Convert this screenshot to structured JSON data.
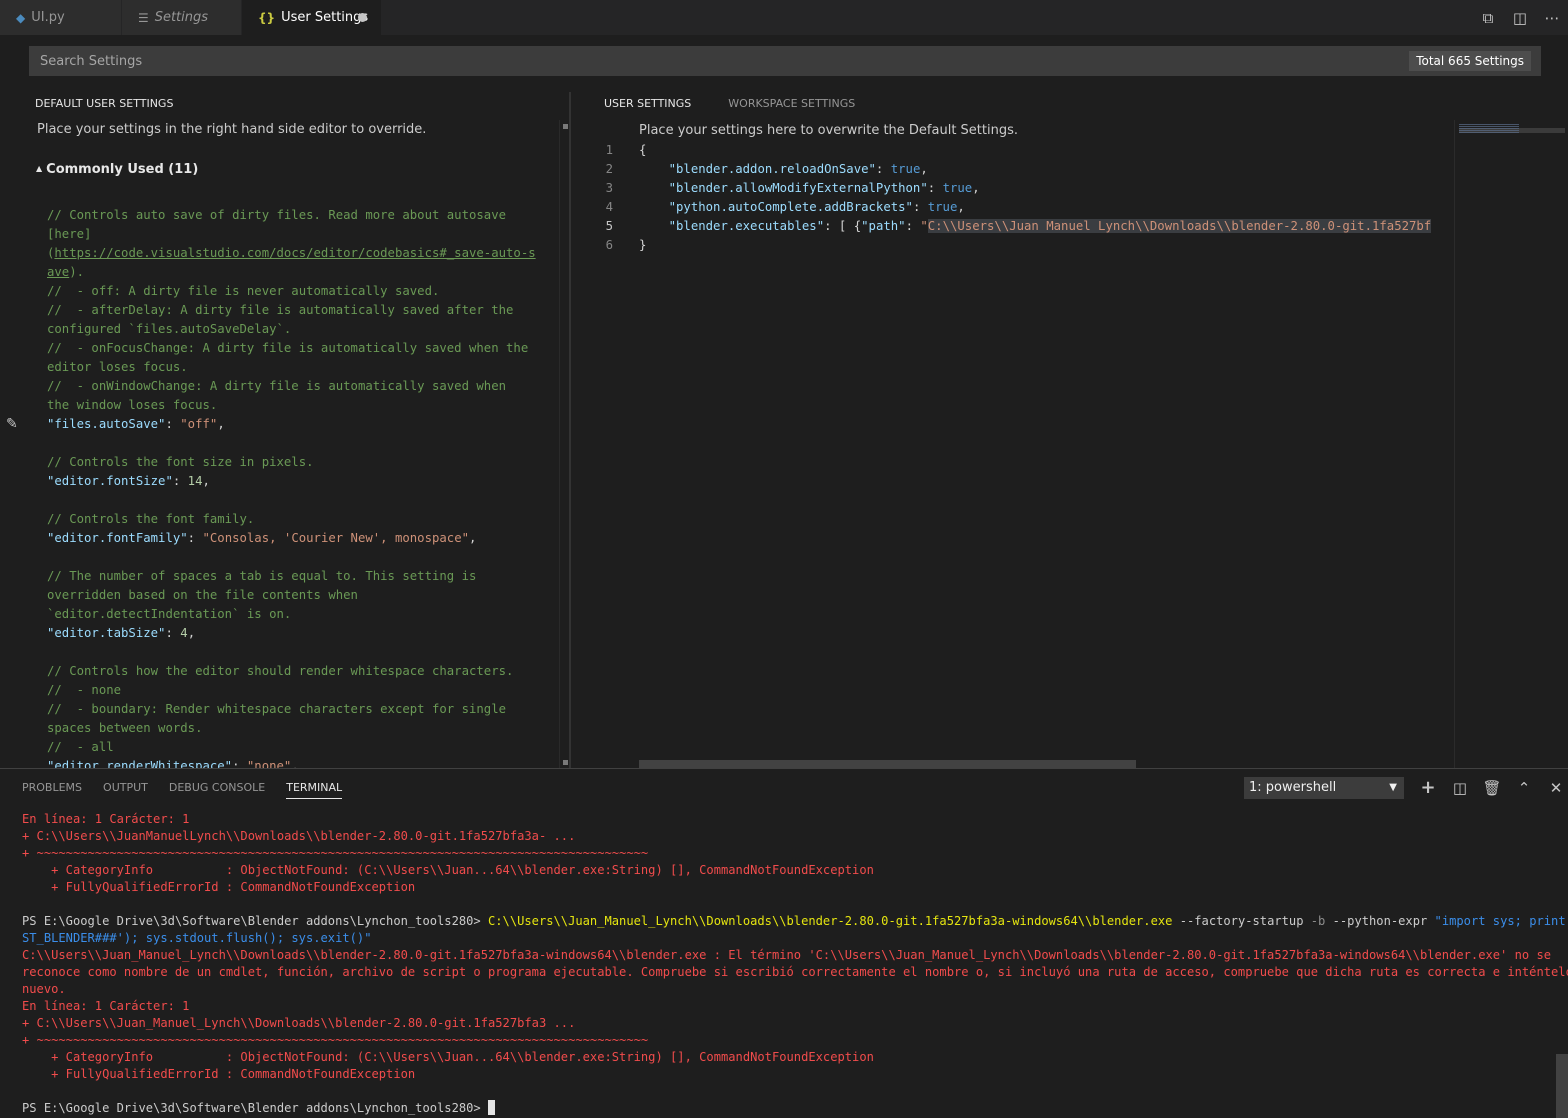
{
  "tabs": [
    {
      "label": "UI.py",
      "icon": "python-icon"
    },
    {
      "label": "Settings",
      "icon": "settings-list-icon"
    },
    {
      "label": "User Settings",
      "icon": "json-braces-icon",
      "dirty": true
    }
  ],
  "tab_actions": [
    "open-changes-icon",
    "split-editor-icon",
    "more-actions-icon"
  ],
  "search": {
    "placeholder": "Search Settings",
    "total": "Total 665 Settings"
  },
  "left": {
    "header": "DEFAULT USER SETTINGS",
    "hint": "Place your settings in the right hand side editor to override.",
    "group": "Commonly Used (11)",
    "code": [
      [
        [
          "cm",
          "// Controls auto save of dirty files. Read more about autosave"
        ]
      ],
      [
        [
          "cm",
          "[here]"
        ]
      ],
      [
        [
          "cm",
          "("
        ],
        [
          "cm lnk",
          "https://code.visualstudio.com/docs/editor/codebasics#_save-auto-s"
        ]
      ],
      [
        [
          "cm lnk",
          "ave"
        ],
        [
          "cm",
          ")."
        ]
      ],
      [
        [
          "cm",
          "//  - off: A dirty file is never automatically saved."
        ]
      ],
      [
        [
          "cm",
          "//  - afterDelay: A dirty file is automatically saved after the"
        ]
      ],
      [
        [
          "cm",
          "configured `files.autoSaveDelay`."
        ]
      ],
      [
        [
          "cm",
          "//  - onFocusChange: A dirty file is automatically saved when the"
        ]
      ],
      [
        [
          "cm",
          "editor loses focus."
        ]
      ],
      [
        [
          "cm",
          "//  - onWindowChange: A dirty file is automatically saved when"
        ]
      ],
      [
        [
          "cm",
          "the window loses focus."
        ]
      ],
      [
        [
          "ky",
          "\"files.autoSave\""
        ],
        [
          "pl",
          ": "
        ],
        [
          "st",
          "\"off\""
        ],
        [
          "pl",
          ","
        ]
      ],
      [],
      [
        [
          "cm",
          "// Controls the font size in pixels."
        ]
      ],
      [
        [
          "ky",
          "\"editor.fontSize\""
        ],
        [
          "pl",
          ": "
        ],
        [
          "nu",
          "14"
        ],
        [
          "pl",
          ","
        ]
      ],
      [],
      [
        [
          "cm",
          "// Controls the font family."
        ]
      ],
      [
        [
          "ky",
          "\"editor.fontFamily\""
        ],
        [
          "pl",
          ": "
        ],
        [
          "st",
          "\"Consolas, 'Courier New', monospace\""
        ],
        [
          "pl",
          ","
        ]
      ],
      [],
      [
        [
          "cm",
          "// The number of spaces a tab is equal to. This setting is"
        ]
      ],
      [
        [
          "cm",
          "overridden based on the file contents when"
        ]
      ],
      [
        [
          "cm",
          "`editor.detectIndentation` is on."
        ]
      ],
      [
        [
          "ky",
          "\"editor.tabSize\""
        ],
        [
          "pl",
          ": "
        ],
        [
          "nu",
          "4"
        ],
        [
          "pl",
          ","
        ]
      ],
      [],
      [
        [
          "cm",
          "// Controls how the editor should render whitespace characters."
        ]
      ],
      [
        [
          "cm",
          "//  - none"
        ]
      ],
      [
        [
          "cm",
          "//  - boundary: Render whitespace characters except for single"
        ]
      ],
      [
        [
          "cm",
          "spaces between words."
        ]
      ],
      [
        [
          "cm",
          "//  - all"
        ]
      ],
      [
        [
          "ky",
          "\"editor.renderWhitespace\""
        ],
        [
          "pl",
          ": "
        ],
        [
          "st",
          "\"none\""
        ],
        [
          "pl",
          ","
        ]
      ]
    ]
  },
  "right": {
    "tabs": [
      "USER SETTINGS",
      "WORKSPACE SETTINGS"
    ],
    "hint": "Place your settings here to overwrite the Default Settings.",
    "lines": [
      {
        "n": "1",
        "parts": [
          [
            "pl",
            "{"
          ]
        ]
      },
      {
        "n": "2",
        "parts": [
          [
            "pl",
            "    "
          ],
          [
            "ky",
            "\"blender.addon.reloadOnSave\""
          ],
          [
            "pl",
            ": "
          ],
          [
            "kw",
            "true"
          ],
          [
            "pl",
            ","
          ]
        ]
      },
      {
        "n": "3",
        "parts": [
          [
            "pl",
            "    "
          ],
          [
            "ky",
            "\"blender.allowModifyExternalPython\""
          ],
          [
            "pl",
            ": "
          ],
          [
            "kw",
            "true"
          ],
          [
            "pl",
            ","
          ]
        ]
      },
      {
        "n": "4",
        "parts": [
          [
            "pl",
            "    "
          ],
          [
            "ky",
            "\"python.autoComplete.addBrackets\""
          ],
          [
            "pl",
            ": "
          ],
          [
            "kw",
            "true"
          ],
          [
            "pl",
            ","
          ]
        ]
      },
      {
        "n": "5",
        "parts": [
          [
            "pl",
            "    "
          ],
          [
            "ky",
            "\"blender.executables\""
          ],
          [
            "pl",
            ": [ {"
          ],
          [
            "ky",
            "\"path\""
          ],
          [
            "pl",
            ": "
          ],
          [
            "st",
            "\""
          ],
          [
            "st sel",
            "C:\\\\Users\\\\Juan Manuel Lynch\\\\Downloads\\\\blender-2.80.0-git.1fa527bf"
          ]
        ]
      },
      {
        "n": "6",
        "parts": [
          [
            "pl",
            "}"
          ]
        ]
      }
    ]
  },
  "panel": {
    "tabs": [
      "PROBLEMS",
      "OUTPUT",
      "DEBUG CONSOLE",
      "TERMINAL"
    ],
    "terminal_select": "1: powershell",
    "actions": [
      "add-terminal-icon",
      "split-terminal-icon",
      "trash-icon",
      "maximize-panel-icon",
      "close-panel-icon"
    ],
    "terminal": [
      [
        [
          "tr",
          "En línea: 1 Carácter: 1"
        ]
      ],
      [
        [
          "tr",
          "+ C:\\\\Users\\\\JuanManuelLynch\\\\Downloads\\\\blender-2.80.0-git.1fa527bfa3a- ..."
        ]
      ],
      [
        [
          "tr",
          "+ ~~~~~~~~~~~~~~~~~~~~~~~~~~~~~~~~~~~~~~~~~~~~~~~~~~~~~~~~~~~~~~~~~~~~~~~~~~~~~~~~~~~~"
        ]
      ],
      [
        [
          "tr",
          "    + CategoryInfo          : ObjectNotFound: (C:\\\\Users\\\\Juan...64\\\\blender.exe:String) [], CommandNotFoundException"
        ]
      ],
      [
        [
          "tr",
          "    + FullyQualifiedErrorId : CommandNotFoundException"
        ]
      ],
      [],
      [
        [
          "tw",
          "PS E:\\Google Drive\\3d\\Software\\Blender addons\\Lynchon_tools280> "
        ],
        [
          "ty",
          "C:\\\\Users\\\\Juan_Manuel_Lynch\\\\Downloads\\\\blender-2.80.0-git.1fa527bfa3a-windows64\\\\blender.exe"
        ],
        [
          "tw",
          " --factory-startup "
        ],
        [
          "tg",
          "-b"
        ],
        [
          "tw",
          " --python-expr "
        ],
        [
          "tb",
          "\"import sys; print('###TE"
        ]
      ],
      [
        [
          "tb",
          "ST_BLENDER###'); sys.stdout.flush(); sys.exit()\""
        ]
      ],
      [
        [
          "tr",
          "C:\\\\Users\\\\Juan_Manuel_Lynch\\\\Downloads\\\\blender-2.80.0-git.1fa527bfa3a-windows64\\\\blender.exe : El término 'C:\\\\Users\\\\Juan_Manuel_Lynch\\\\Downloads\\\\blender-2.80.0-git.1fa527bfa3a-windows64\\\\blender.exe' no se"
        ]
      ],
      [
        [
          "tr",
          "reconoce como nombre de un cmdlet, función, archivo de script o programa ejecutable. Compruebe si escribió correctamente el nombre o, si incluyó una ruta de acceso, compruebe que dicha ruta es correcta e inténtelo de"
        ]
      ],
      [
        [
          "tr",
          "nuevo."
        ]
      ],
      [
        [
          "tr",
          "En línea: 1 Carácter: 1"
        ]
      ],
      [
        [
          "tr",
          "+ C:\\\\Users\\\\Juan_Manuel_Lynch\\\\Downloads\\\\blender-2.80.0-git.1fa527bfa3 ..."
        ]
      ],
      [
        [
          "tr",
          "+ ~~~~~~~~~~~~~~~~~~~~~~~~~~~~~~~~~~~~~~~~~~~~~~~~~~~~~~~~~~~~~~~~~~~~~~~~~~~~~~~~~~~~"
        ]
      ],
      [
        [
          "tr",
          "    + CategoryInfo          : ObjectNotFound: (C:\\\\Users\\\\Juan...64\\\\blender.exe:String) [], CommandNotFoundException"
        ]
      ],
      [
        [
          "tr",
          "    + FullyQualifiedErrorId : CommandNotFoundException"
        ]
      ],
      [],
      [
        [
          "tw",
          "PS E:\\Google Drive\\3d\\Software\\Blender addons\\Lynchon_tools280> "
        ]
      ]
    ]
  }
}
